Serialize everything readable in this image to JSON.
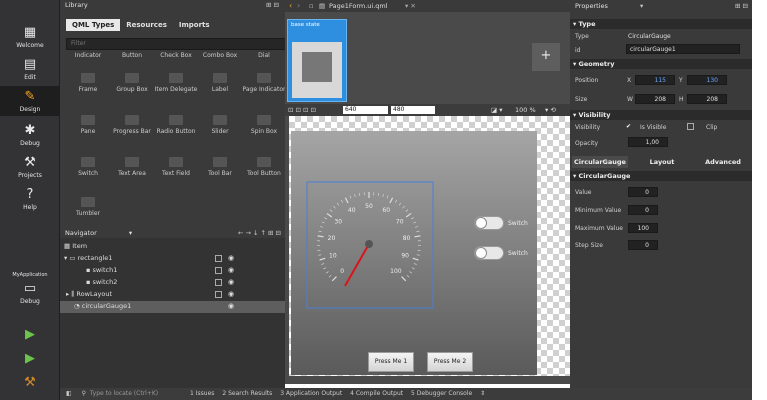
{
  "modebar": {
    "items": [
      {
        "label": "Welcome",
        "icon": "grid-icon",
        "glyph": "▦"
      },
      {
        "label": "Edit",
        "icon": "document-icon",
        "glyph": "▤"
      },
      {
        "label": "Design",
        "icon": "pencil-icon",
        "glyph": "✎"
      },
      {
        "label": "Debug",
        "icon": "bug-icon",
        "glyph": "✱"
      },
      {
        "label": "Projects",
        "icon": "wrench-icon",
        "glyph": "⚒"
      },
      {
        "label": "Help",
        "icon": "help-icon",
        "glyph": "?"
      }
    ],
    "kit": "MyApplication",
    "kit_mode": "Debug"
  },
  "library": {
    "title": "Library",
    "tabs": [
      "QML Types",
      "Resources",
      "Imports"
    ],
    "filter_placeholder": "Filter",
    "items": [
      "Indicator",
      "Button",
      "Check Box",
      "Combo Box",
      "Dial",
      "Frame",
      "Group Box",
      "Item Delegate",
      "Label",
      "Page Indicator",
      "Pane",
      "Progress Bar",
      "Radio Button",
      "Slider",
      "Spin Box",
      "Switch",
      "Text Area",
      "Text Field",
      "Tool Bar",
      "Tool Button",
      "Tumbler"
    ]
  },
  "navigator": {
    "title": "Navigator",
    "rows": [
      "Item",
      "rectangle1",
      "switch1",
      "switch2",
      "RowLayout",
      "circularGauge1"
    ]
  },
  "editor": {
    "filename": "Page1Form.ui.qml",
    "base_state": "base state",
    "width": "640",
    "height": "480",
    "zoom": "100 %"
  },
  "canvas": {
    "switch_label": "Switch",
    "button1": "Press Me 1",
    "button2": "Press Me 2",
    "gauge_ticks": [
      "0",
      "10",
      "20",
      "30",
      "40",
      "50",
      "60",
      "70",
      "80",
      "90",
      "100"
    ]
  },
  "properties": {
    "title": "Properties",
    "type_section": "Type",
    "type_label": "Type",
    "type_value": "CircularGauge",
    "id_label": "id",
    "id_value": "circularGauge1",
    "geometry_section": "Geometry",
    "position_label": "Position",
    "x": "115",
    "y": "130",
    "size_label": "Size",
    "w": "208",
    "h": "208",
    "visibility_section": "Visibility",
    "visibility_label": "Visibility",
    "is_visible": "Is Visible",
    "clip": "Clip",
    "opacity_label": "Opacity",
    "opacity": "1,00",
    "tabs": [
      "CircularGauge",
      "Layout",
      "Advanced"
    ],
    "gauge_section": "CircularGauge",
    "value_label": "Value",
    "value": "0",
    "min_label": "Minimum Value",
    "min": "0",
    "max_label": "Maximum Value",
    "max": "100",
    "step_label": "Step Size",
    "step": "0"
  },
  "status": {
    "locate_placeholder": "Type to locate (Ctrl+K)",
    "items": [
      "1 Issues",
      "2 Search Results",
      "3 Application Output",
      "4 Compile Output",
      "5 Debugger Console"
    ]
  }
}
